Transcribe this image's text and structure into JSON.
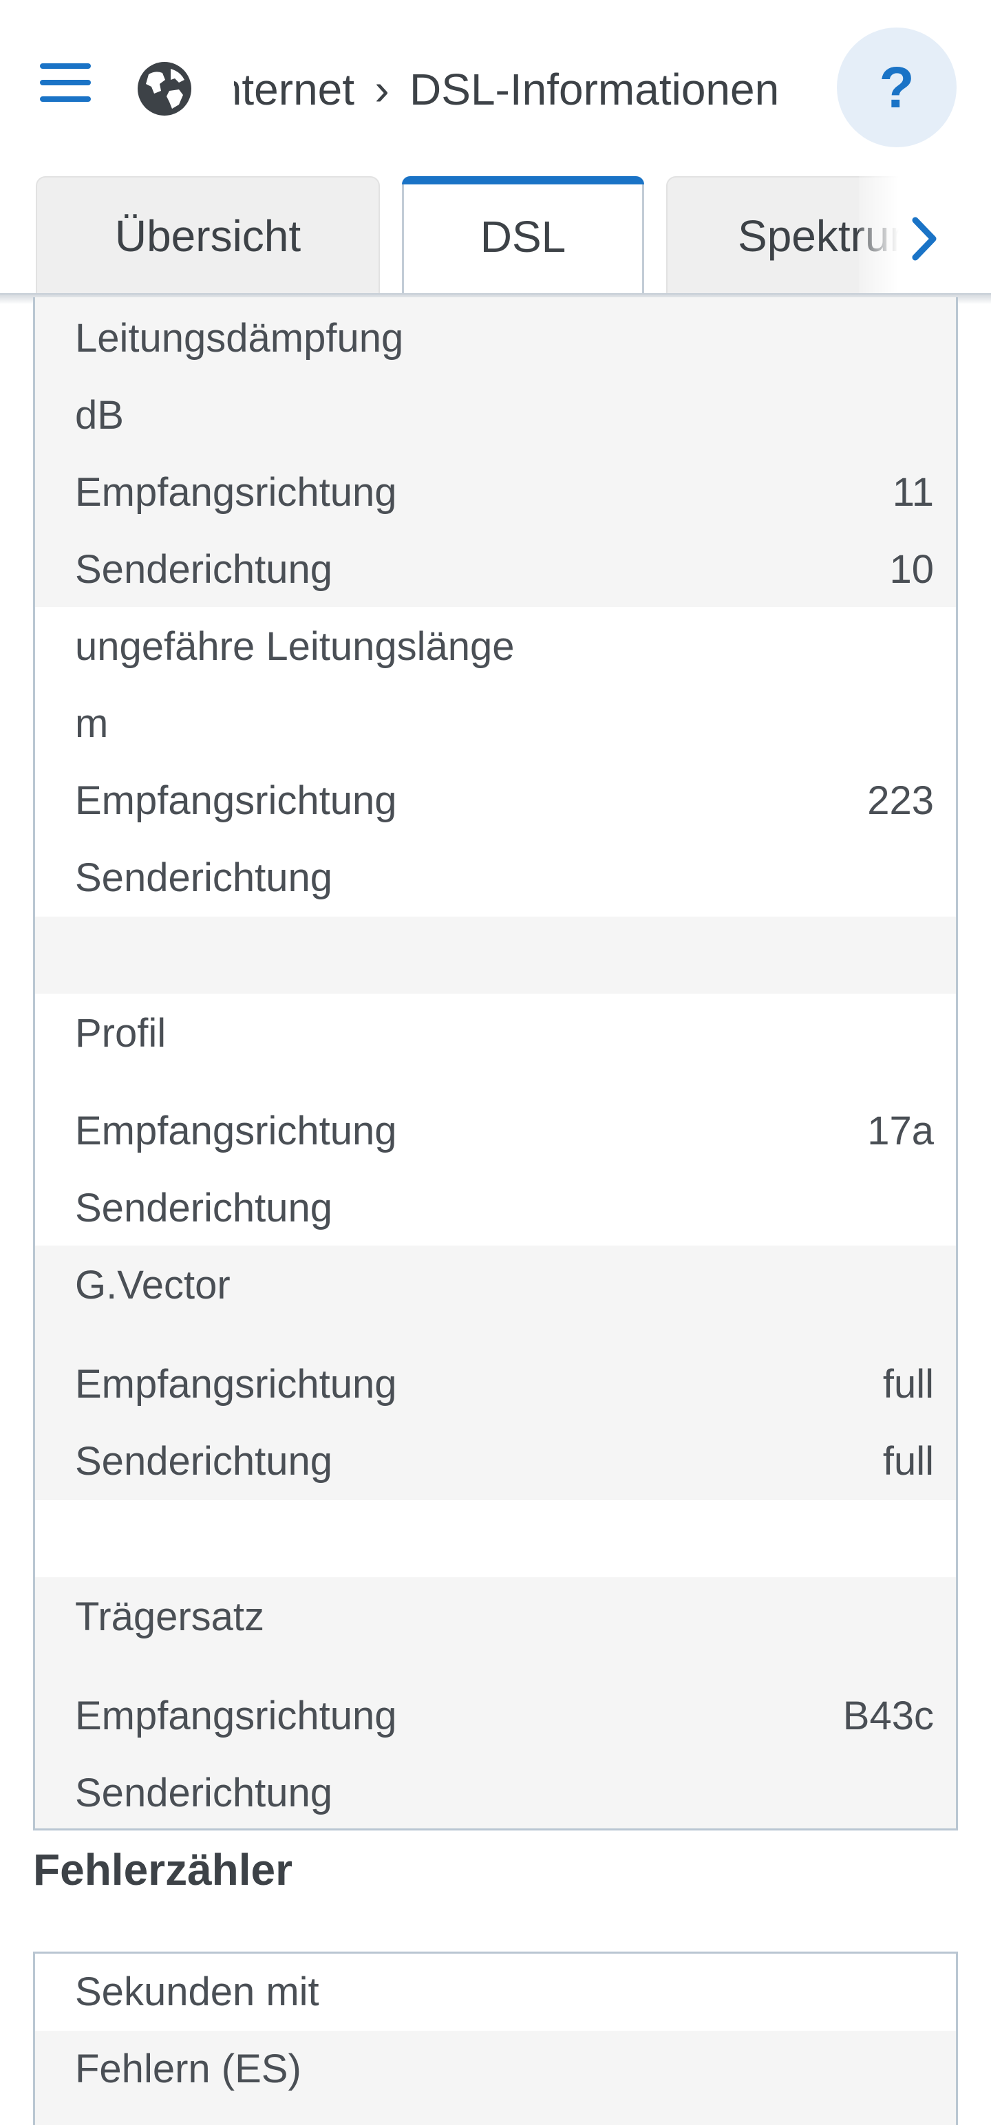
{
  "header": {
    "breadcrumb": {
      "parent": "Internet",
      "separator": "›",
      "current": "DSL-Informationen"
    },
    "help_label": "?"
  },
  "tabs": [
    {
      "label": "Übersicht",
      "active": false
    },
    {
      "label": "DSL",
      "active": true
    },
    {
      "label": "Spektrum",
      "active": false
    }
  ],
  "dsl_table": {
    "attenuation": {
      "label": "Leitungsdämpfung",
      "unit": "dB",
      "downstream_label": "Empfangsrichtung",
      "downstream_value": "11",
      "upstream_label": "Senderichtung",
      "upstream_value": "10"
    },
    "line_length": {
      "label": "ungefähre Leitungslänge",
      "unit": "m",
      "downstream_label": "Empfangsrichtung",
      "downstream_value": "223",
      "upstream_label": "Senderichtung",
      "upstream_value": ""
    },
    "profile": {
      "label": "Profil",
      "downstream_label": "Empfangsrichtung",
      "downstream_value": "17a",
      "upstream_label": "Senderichtung",
      "upstream_value": ""
    },
    "gvector": {
      "label": "G.Vector",
      "downstream_label": "Empfangsrichtung",
      "downstream_value": "full",
      "upstream_label": "Senderichtung",
      "upstream_value": "full"
    },
    "carrier_set": {
      "label": "Trägersatz",
      "downstream_label": "Empfangsrichtung",
      "downstream_value": "B43c",
      "upstream_label": "Senderichtung",
      "upstream_value": ""
    }
  },
  "error_counter": {
    "title": "Fehlerzähler",
    "rows": [
      "Sekunden mit",
      "Fehlern (ES)"
    ]
  },
  "colors": {
    "accent": "#1a73c6",
    "row_gray": "#f5f5f5",
    "border": "#b9c6d2"
  }
}
